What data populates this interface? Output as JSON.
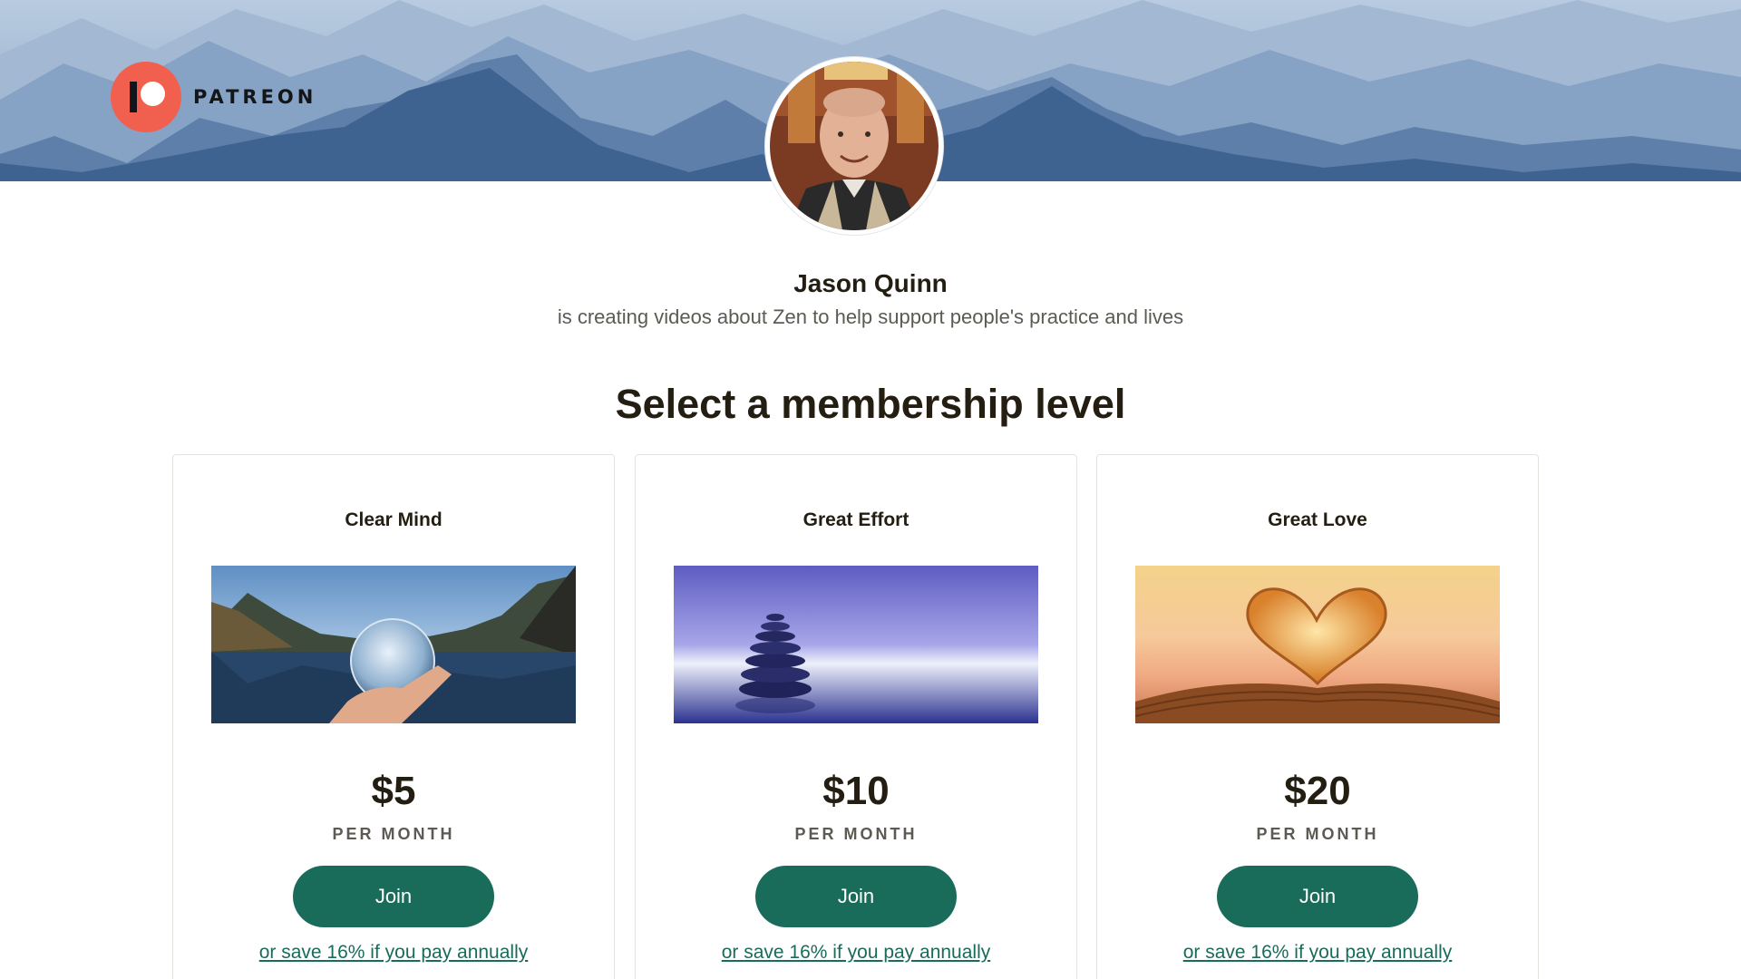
{
  "brand": {
    "name": "PATREON",
    "accent": "#f1604f",
    "primary": "#196b5a"
  },
  "creator": {
    "name": "Jason Quinn",
    "description": "is creating videos about Zen to help support people's practice and lives"
  },
  "section_title": "Select a membership level",
  "tiers": [
    {
      "name": "Clear Mind",
      "image": "crystal-ball-lake-image",
      "price": "$5",
      "period": "PER MONTH",
      "join_label": "Join",
      "annual_label": "or save 16% if you pay annually"
    },
    {
      "name": "Great Effort",
      "image": "stacked-stones-image",
      "price": "$10",
      "period": "PER MONTH",
      "join_label": "Join",
      "annual_label": "or save 16% if you pay annually"
    },
    {
      "name": "Great Love",
      "image": "book-heart-image",
      "price": "$20",
      "period": "PER MONTH",
      "join_label": "Join",
      "annual_label": "or save 16% if you pay annually"
    }
  ]
}
